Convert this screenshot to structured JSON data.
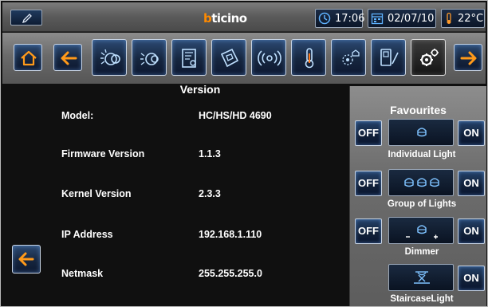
{
  "status_bar": {
    "brand": "bticino",
    "brand_accent": "b",
    "brand_rest": "ticino",
    "time": "17:06",
    "date": "02/07/10",
    "temperature": "22°C"
  },
  "toolbar": {
    "buttons": [
      {
        "icon": "home-icon"
      },
      {
        "icon": "arrow-left-icon"
      },
      {
        "icon": "lighting-icon"
      },
      {
        "icon": "automation-icon"
      },
      {
        "icon": "scenarios-icon"
      },
      {
        "icon": "energy-icon"
      },
      {
        "icon": "sound-system-icon"
      },
      {
        "icon": "temperature-icon"
      },
      {
        "icon": "video-icon"
      },
      {
        "icon": "messages-icon"
      },
      {
        "icon": "settings-icon"
      },
      {
        "icon": "arrow-right-icon"
      }
    ]
  },
  "version": {
    "title": "Version",
    "rows": [
      {
        "label": "Model:",
        "value": "HC/HS/HD 4690"
      },
      {
        "label": "Firmware Version",
        "value": "1.1.3"
      },
      {
        "label": "Kernel Version",
        "value": "2.3.3"
      },
      {
        "label": "IP Address",
        "value": "192.168.1.110"
      },
      {
        "label": "Netmask",
        "value": "255.255.255.0"
      }
    ]
  },
  "favourites": {
    "title": "Favourites",
    "items": [
      {
        "label": "Individual Light",
        "off": "OFF",
        "on": "ON",
        "icon": "single-light-icon"
      },
      {
        "label": "Group of Lights",
        "off": "OFF",
        "on": "ON",
        "icon": "group-lights-icon"
      },
      {
        "label": "Dimmer",
        "off": "OFF",
        "on": "ON",
        "icon": "dimmer-icon"
      },
      {
        "label": "StaircaseLight",
        "on": "ON",
        "icon": "staircase-light-icon"
      }
    ]
  },
  "colors": {
    "accent_orange": "#ff8a00",
    "button_blue": "#16263f",
    "panel_grey": "#6d6d6d"
  }
}
